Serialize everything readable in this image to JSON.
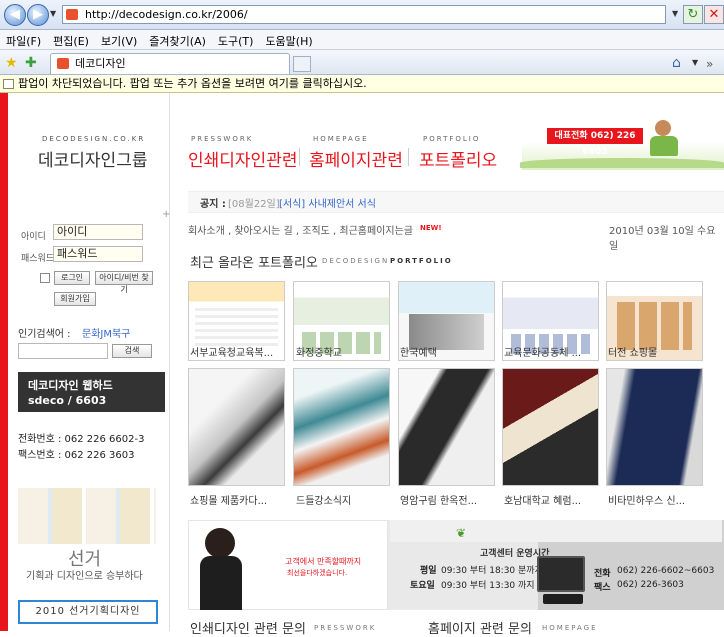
{
  "browser": {
    "url": "http://decodesign.co.kr/2006/",
    "tab_title": "데코디자인",
    "menu": [
      "파일(F)",
      "편집(E)",
      "보기(V)",
      "즐겨찾기(A)",
      "도구(T)",
      "도움말(H)"
    ],
    "popup_notice": "팝업이 차단되었습니다. 팝업 또는 추가 옵션을 보려면 여기를 클릭하십시오."
  },
  "logo": {
    "small": "DECODESIGN.CO.KR",
    "main": "데코디자인그룹"
  },
  "nav": [
    {
      "small": "PRESSWORK",
      "label": "인쇄디자인관련"
    },
    {
      "small": "HOMEPAGE",
      "label": "홈페이지관련"
    },
    {
      "small": "PORTFOLIO",
      "label": "포트폴리오"
    }
  ],
  "phone_badge": "대표전화 062) 226 6603",
  "login": {
    "id_label": "아이디",
    "id_value": "아이디",
    "pw_label": "패스워드",
    "pw_value": "패스워드",
    "login_btn": "로그인",
    "find_btn": "아이디/비번 찾기",
    "join_btn": "회원가입"
  },
  "popular": {
    "label": "인기검색어 :",
    "value": "문화JM북구",
    "search_btn": "검색"
  },
  "webhard": {
    "line1": "데코디자인 웹하드",
    "line2": "sdeco / 6603"
  },
  "contact": {
    "phone": "전화번호 : 062 226 6602-3",
    "fax": "팩스번호 : 062 226 3603"
  },
  "election": {
    "title": "선거",
    "subtitle": "기획과 디자인으로 승부하다",
    "button": "2010 선거기획디자인"
  },
  "notice": {
    "label": "공지 :",
    "date": "[08월22일]",
    "text": "[서식] 사내제안서 서식"
  },
  "links": {
    "text": "회사소개 , 찾아오시는 길 , 조직도 , 최근홈페이지는글",
    "new": "NEW!"
  },
  "today": "2010년 03월 10일 수요일",
  "portfolio": {
    "title": "최근 올라온 포트폴리오",
    "sub1": "DECODESIGN",
    "sub2": "PORTFOLIO",
    "row1": [
      "서부교육청교육복...",
      "화정중학교",
      "한국예택",
      "교육문화공동체 ...",
      "터전 쇼핑몰"
    ],
    "row2": [
      "쇼핑몰 제품카다...",
      "드들강소식지",
      "영암구림 한옥전...",
      "호남대학교 혜럼...",
      "비타민하우스 신..."
    ]
  },
  "banner": {
    "left_line1": "고객에서 만족할때까지",
    "left_line2": "최선을다하겠습니다.",
    "cs_title": "고객센터 운영시간",
    "weekday_label": "평일",
    "weekday_hours": "09:30 부터 18:30 분까지",
    "sat_label": "토요일",
    "sat_hours": "09:30 부터 13:30 까지",
    "tel_label": "전화",
    "tel": "062) 226-6602~6603",
    "fax_label": "팩스",
    "fax": "062) 226-3603"
  },
  "bottom": {
    "left_title": "인쇄디자인 관련 문의",
    "left_small": "PRESSWORK",
    "right_title": "홈페이지 관련 문의",
    "right_small": "HOMEPAGE"
  }
}
